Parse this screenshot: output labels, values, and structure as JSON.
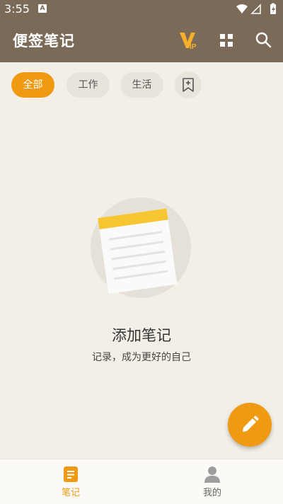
{
  "status_bar": {
    "time": "3:55",
    "notification_badge": "A"
  },
  "app_bar": {
    "title": "便签笔记",
    "vip_icon": "vip-icon",
    "grid_icon": "grid-icon",
    "search_icon": "search-icon"
  },
  "tabs": [
    {
      "label": "全部",
      "active": true
    },
    {
      "label": "工作",
      "active": false
    },
    {
      "label": "生活",
      "active": false
    }
  ],
  "empty_state": {
    "title": "添加笔记",
    "subtitle": "记录，成为更好的自己"
  },
  "fab": {
    "icon": "pencil-icon"
  },
  "bottom_nav": [
    {
      "label": "笔记",
      "active": true,
      "icon": "note-icon"
    },
    {
      "label": "我的",
      "active": false,
      "icon": "person-icon"
    }
  ],
  "colors": {
    "brown": "#7b6a57",
    "accent": "#f09a14",
    "background": "#f2efe6",
    "chip": "#e7e4dc"
  }
}
